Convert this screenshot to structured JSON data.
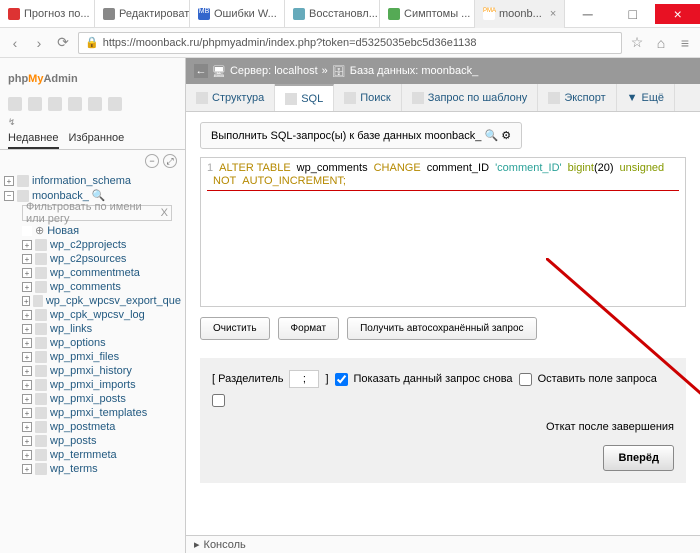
{
  "browser": {
    "tabs": [
      {
        "label": "Прогноз по...",
        "color": "#d33"
      },
      {
        "label": "Редактировать ...",
        "color": "#888"
      },
      {
        "label": "Ошибки W...",
        "color": "#36c",
        "prefix": "MB"
      },
      {
        "label": "Восстановл...",
        "color": "#6ab"
      },
      {
        "label": "Симптомы ...",
        "color": "#5a5"
      },
      {
        "label": "moonb...",
        "color": "#f90",
        "sub": "PMA"
      }
    ],
    "url": "https://moonback.ru/phpmyadmin/index.php?token=d5325035ebc5d36e1138"
  },
  "logo": {
    "php": "php",
    "my": "My",
    "admin": "Admin"
  },
  "nav": {
    "recent": "Недавнее",
    "fav": "Избранное"
  },
  "tree": {
    "db1": "information_schema",
    "db2": "moonback_",
    "filter": "Фильтровать по имени или регу",
    "new": "Новая",
    "tables": [
      "wp_c2pprojects",
      "wp_c2psources",
      "wp_commentmeta",
      "wp_comments",
      "wp_cpk_wpcsv_export_que",
      "wp_cpk_wpcsv_log",
      "wp_links",
      "wp_options",
      "wp_pmxi_files",
      "wp_pmxi_history",
      "wp_pmxi_imports",
      "wp_pmxi_posts",
      "wp_pmxi_templates",
      "wp_postmeta",
      "wp_posts",
      "wp_termmeta",
      "wp_terms"
    ]
  },
  "breadcrumb": {
    "server": "Сервер: localhost",
    "db": "База данных: moonback_"
  },
  "contentTabs": {
    "structure": "Структура",
    "sql": "SQL",
    "search": "Поиск",
    "query": "Запрос по шаблону",
    "export": "Экспорт",
    "more": "Ещё"
  },
  "sql": {
    "header": "Выполнить SQL-запрос(ы) к базе данных moonback_",
    "query": {
      "p1": "ALTER TABLE",
      "p2": "wp_comments",
      "p3": "CHANGE",
      "p4": "comment_ID",
      "p5": "'comment_ID'",
      "p6": "bigint",
      "p7": "(20)",
      "p8": "unsigned",
      "p9": "NOT",
      "p10": "AUTO_INCREMENT;"
    },
    "clear": "Очистить",
    "format": "Формат",
    "autosave": "Получить автосохранённый запрос",
    "delimiter": "[ Разделитель",
    "delVal": ";",
    "delEnd": "]",
    "showAgain": "Показать данный запрос снова",
    "keepField": "Оставить поле запроса",
    "rollback": "Откат после завершения",
    "go": "Вперёд"
  },
  "console": "Консоль"
}
